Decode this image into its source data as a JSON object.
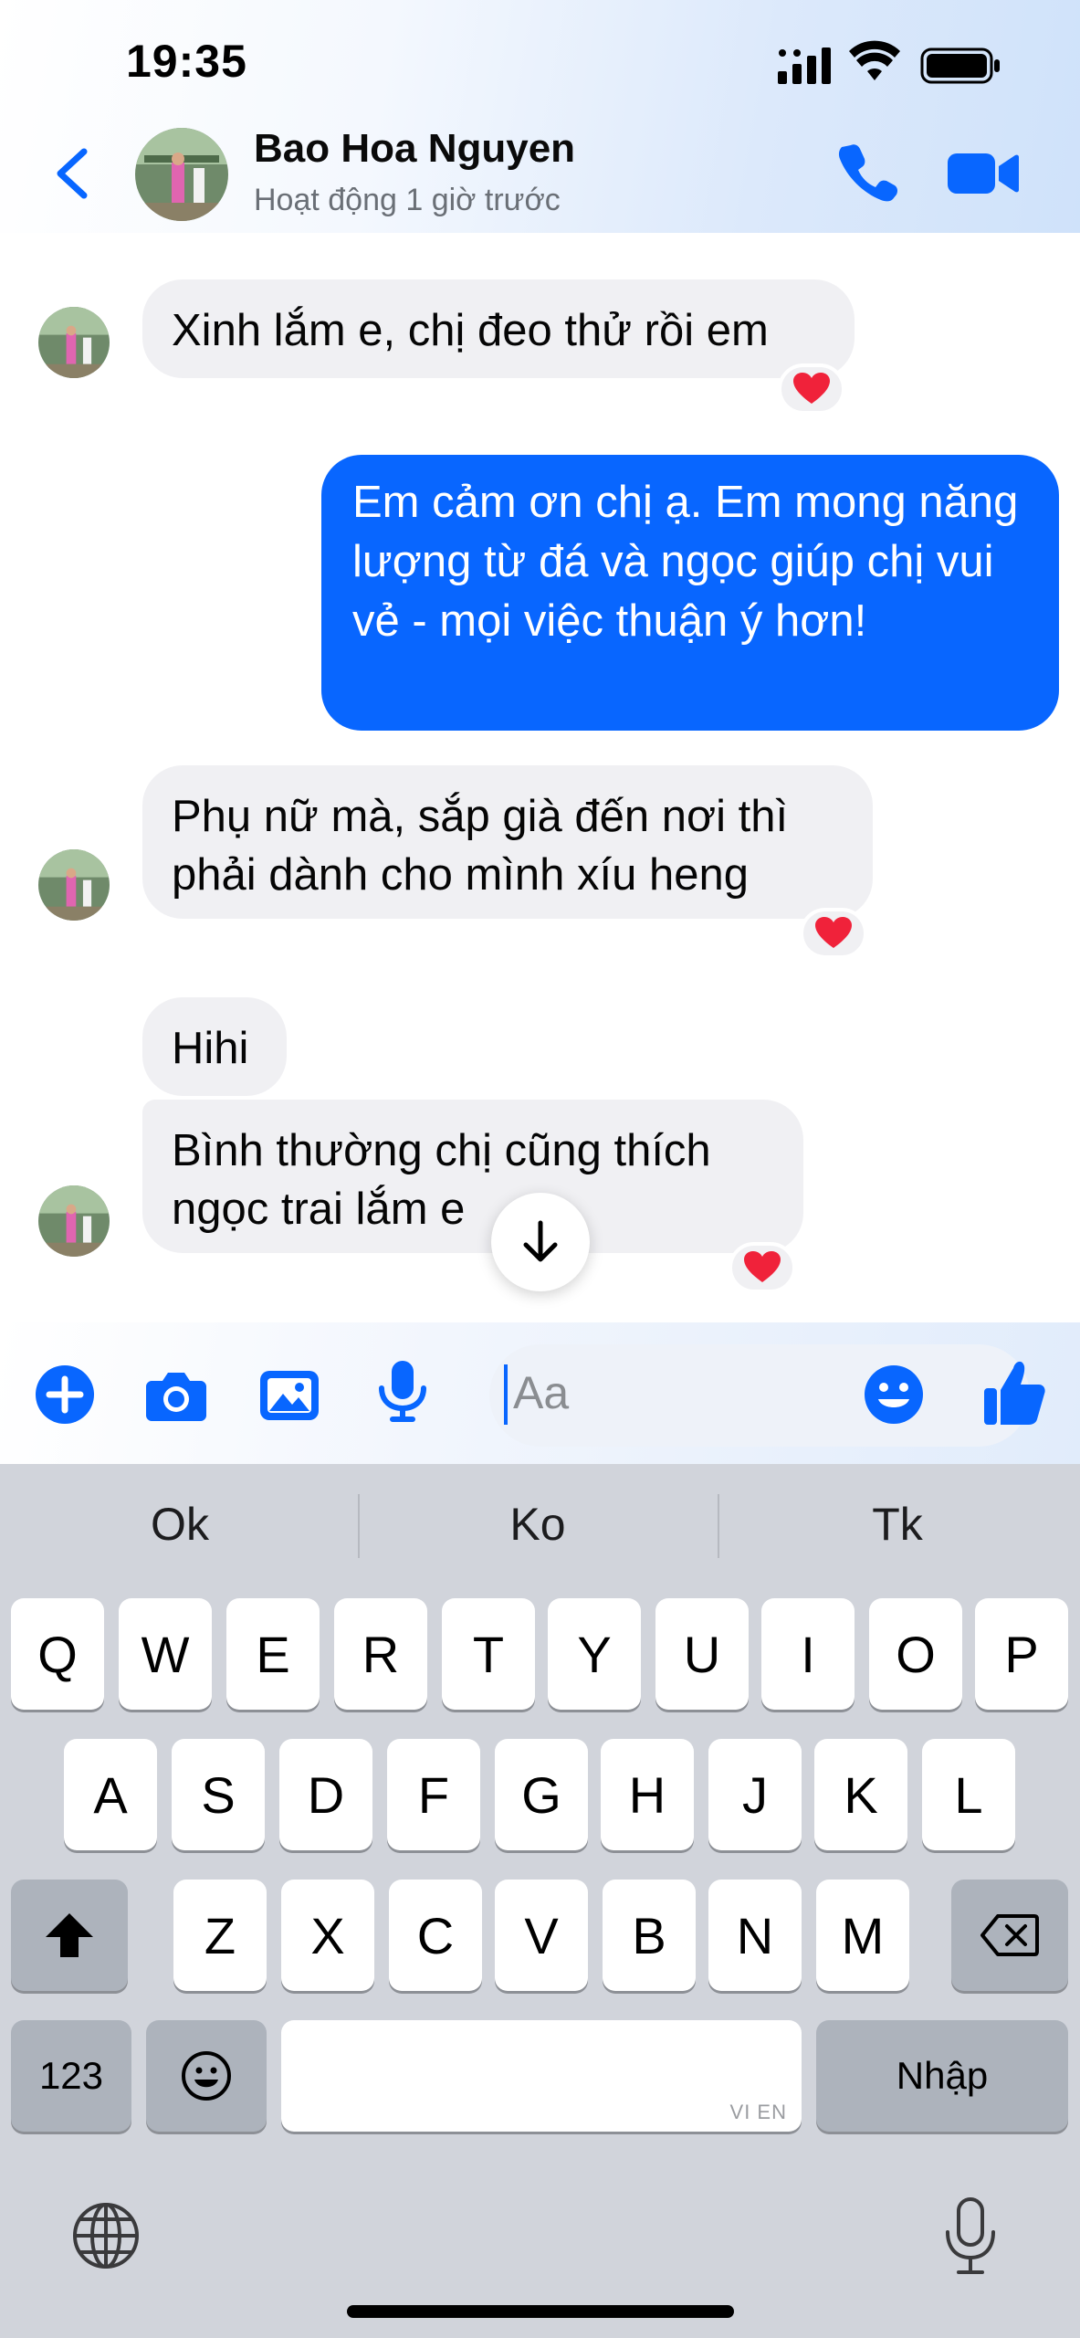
{
  "status_bar": {
    "time": "19:35"
  },
  "header": {
    "contact_name": "Bao Hoa Nguyen",
    "contact_status": "Hoạt động 1 giờ trước",
    "icons": [
      "back-icon",
      "avatar",
      "phone-icon",
      "video-icon"
    ]
  },
  "messages": [
    {
      "direction": "incoming",
      "text": "Xinh lắm e, chị đeo thử rồi em",
      "reaction": "❤️"
    },
    {
      "direction": "outgoing",
      "text": "Em cảm ơn chị ạ. Em mong năng lượng từ đá và ngọc giúp chị vui vẻ - mọi việc thuận ý hơn!"
    },
    {
      "direction": "incoming",
      "text": "Phụ nữ mà, sắp già đến nơi thì phải dành cho mình xíu heng",
      "reaction": "❤️"
    },
    {
      "direction": "incoming",
      "text": "Hihi"
    },
    {
      "direction": "incoming",
      "text": "Bình thường chị cũng thích ngọc trai lắm e",
      "reaction": "❤️"
    }
  ],
  "composer": {
    "placeholder": "Aa",
    "icons": [
      "plus-icon",
      "camera-icon",
      "image-icon",
      "microphone-icon",
      "emoji-icon",
      "thumbs-up-icon"
    ]
  },
  "keyboard": {
    "suggestions": [
      "Ok",
      "Ko",
      "Tk"
    ],
    "row1": [
      "Q",
      "W",
      "E",
      "R",
      "T",
      "Y",
      "U",
      "I",
      "O",
      "P"
    ],
    "row2": [
      "A",
      "S",
      "D",
      "F",
      "G",
      "H",
      "J",
      "K",
      "L"
    ],
    "row3": [
      "Z",
      "X",
      "C",
      "V",
      "B",
      "N",
      "M"
    ],
    "numbers_key": "123",
    "enter_key": "Nhập",
    "space_hint": "VI EN"
  },
  "colors": {
    "accent": "#0866ff",
    "incoming_bubble": "#f0f0f3",
    "keyboard_bg": "#d1d4db"
  }
}
